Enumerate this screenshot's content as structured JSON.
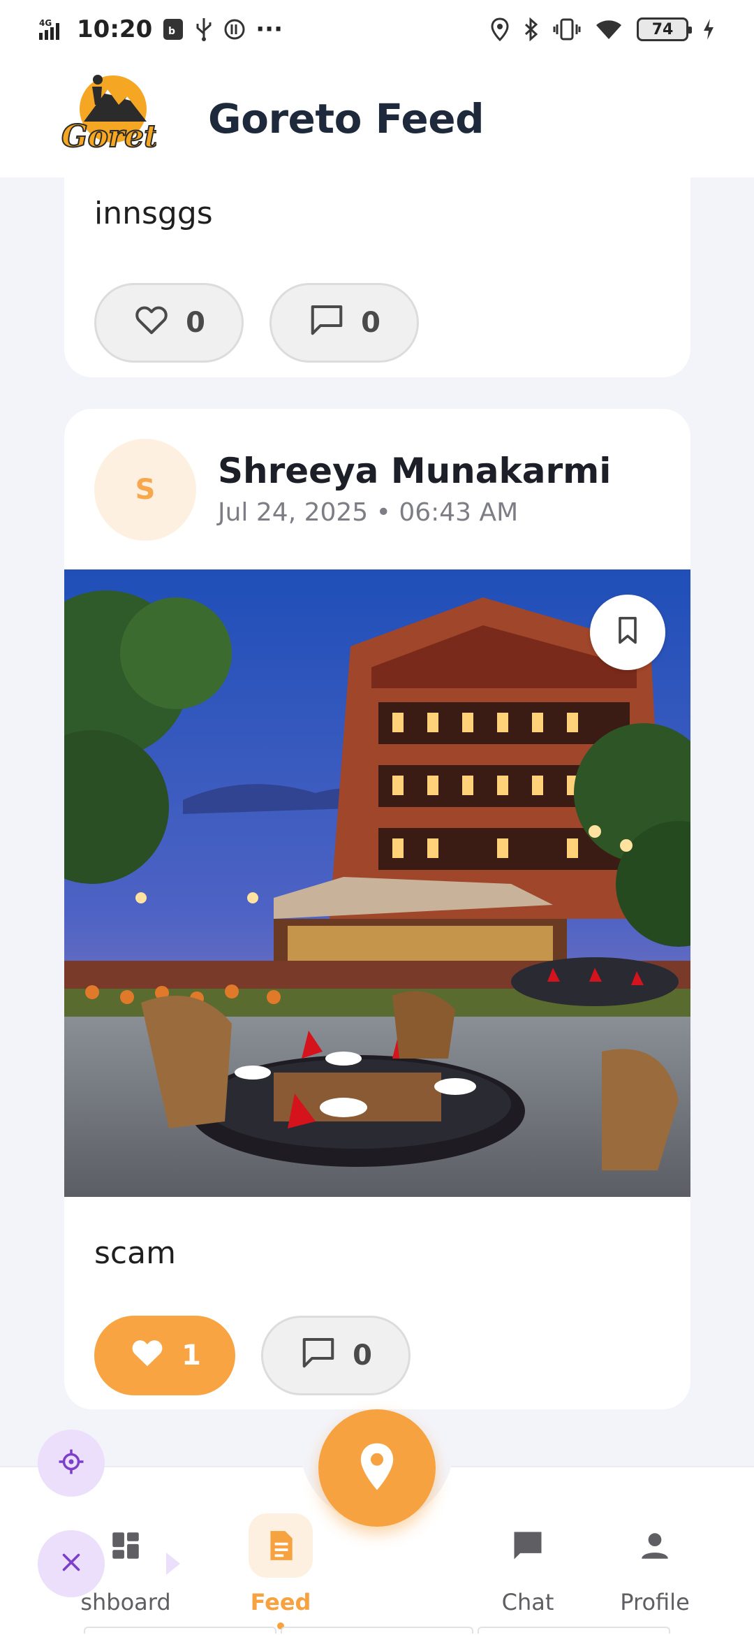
{
  "status_bar": {
    "network": "4G",
    "time": "10:20",
    "more": "···",
    "battery": "74"
  },
  "header": {
    "logo_text": "Goreto",
    "title": "Goreto Feed"
  },
  "posts": [
    {
      "text": "innsggs",
      "likes": "0",
      "comments": "0",
      "liked": false
    },
    {
      "avatar_initial": "S",
      "author": "Shreeya Munakarmi",
      "timestamp": "Jul 24, 2025 • 06:43 AM",
      "image_subject": "courtyard restaurant at dusk",
      "text": "scam",
      "likes": "1",
      "comments": "0",
      "liked": true
    }
  ],
  "bottom_nav": {
    "items": [
      {
        "label": "shboard",
        "icon": "dashboard-icon"
      },
      {
        "label": "Feed",
        "icon": "document-icon",
        "active": true
      },
      {
        "label": "Chat",
        "icon": "chat-icon"
      },
      {
        "label": "Profile",
        "icon": "person-icon"
      }
    ]
  },
  "colors": {
    "accent": "#f7a240",
    "accent_light": "#fdf0e1",
    "fab_purple": "#ecdffb",
    "fab_purple_icon": "#7b3fc9",
    "background": "#f3f4fa",
    "title": "#1e2a3b"
  }
}
